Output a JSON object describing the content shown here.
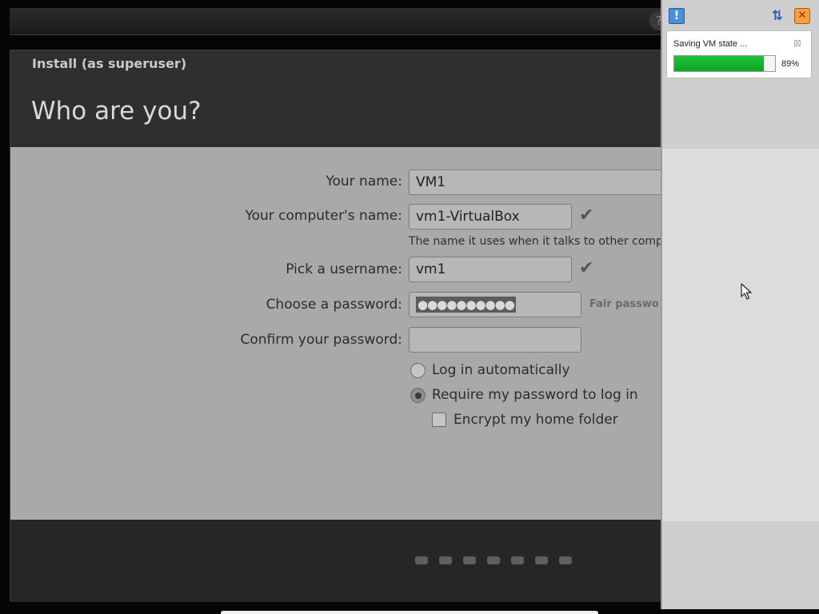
{
  "installer": {
    "title": "Install (as superuser)",
    "heading": "Who are you?",
    "help_glyph": "?",
    "fields": {
      "your_name": {
        "label": "Your name:",
        "value": "VM1"
      },
      "computer_name": {
        "label": "Your computer's name:",
        "value": "vm1-VirtualBox",
        "hint": "The name it uses when it talks to other compu"
      },
      "username": {
        "label": "Pick a username:",
        "value": "vm1"
      },
      "password": {
        "label": "Choose a password:",
        "masked_value": "●●●●●●●●●●",
        "strength": "Fair passwo"
      },
      "confirm_password": {
        "label": "Confirm your password:",
        "value": ""
      }
    },
    "login_options": {
      "auto_login": {
        "label": "Log in automatically",
        "selected": false
      },
      "require_password": {
        "label": "Require my password to log in",
        "selected": true
      },
      "encrypt_home": {
        "label": "Encrypt my home folder",
        "checked": false
      }
    },
    "check_glyph": "✔",
    "step_count": 7
  },
  "virtualbox": {
    "toolbar": {
      "message_icon": "notification-center-icon",
      "sort_icon": "sort-icon",
      "close_all_icon": "close-all-icon"
    },
    "notification": {
      "text": "Saving VM state ...",
      "progress_fraction": 0.89,
      "progress_label": "89%"
    }
  },
  "colors": {
    "progress_green": "#12b02a",
    "form_background": "#a9a9a9",
    "window_background": "#2f2f2f"
  }
}
